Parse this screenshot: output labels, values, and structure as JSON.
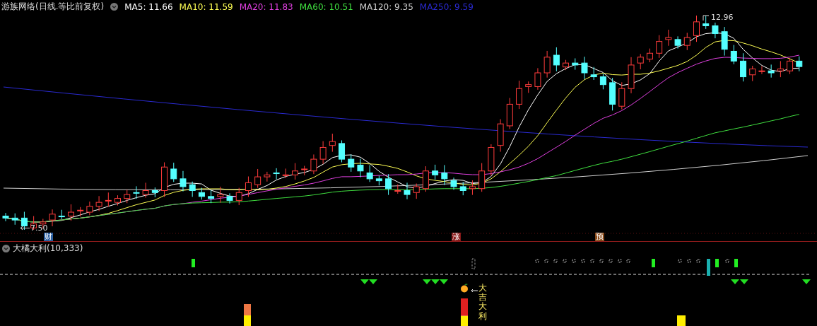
{
  "title": "游族网络(日线.等比前复权)",
  "ma_legend": [
    {
      "label": "MA5: 11.66",
      "color": "#ffffff"
    },
    {
      "label": "MA10: 11.59",
      "color": "#ffff54"
    },
    {
      "label": "MA20: 11.83",
      "color": "#e040e0"
    },
    {
      "label": "MA60: 10.51",
      "color": "#40e040"
    },
    {
      "label": "MA120: 9.35",
      "color": "#d0d0d0"
    },
    {
      "label": "MA250: 9.59",
      "color": "#2a2ad0"
    }
  ],
  "price_annotations": {
    "high": "12.96",
    "low": "7.50"
  },
  "event_badges": [
    {
      "text": "财",
      "color": "#2a5ea0"
    },
    {
      "text": "涨",
      "color": "#8a1a1a"
    },
    {
      "text": "预",
      "color": "#8a4a1a"
    }
  ],
  "indicator": {
    "title": "大橘大利(10,333)",
    "signal_label": "大吉大利"
  }
}
